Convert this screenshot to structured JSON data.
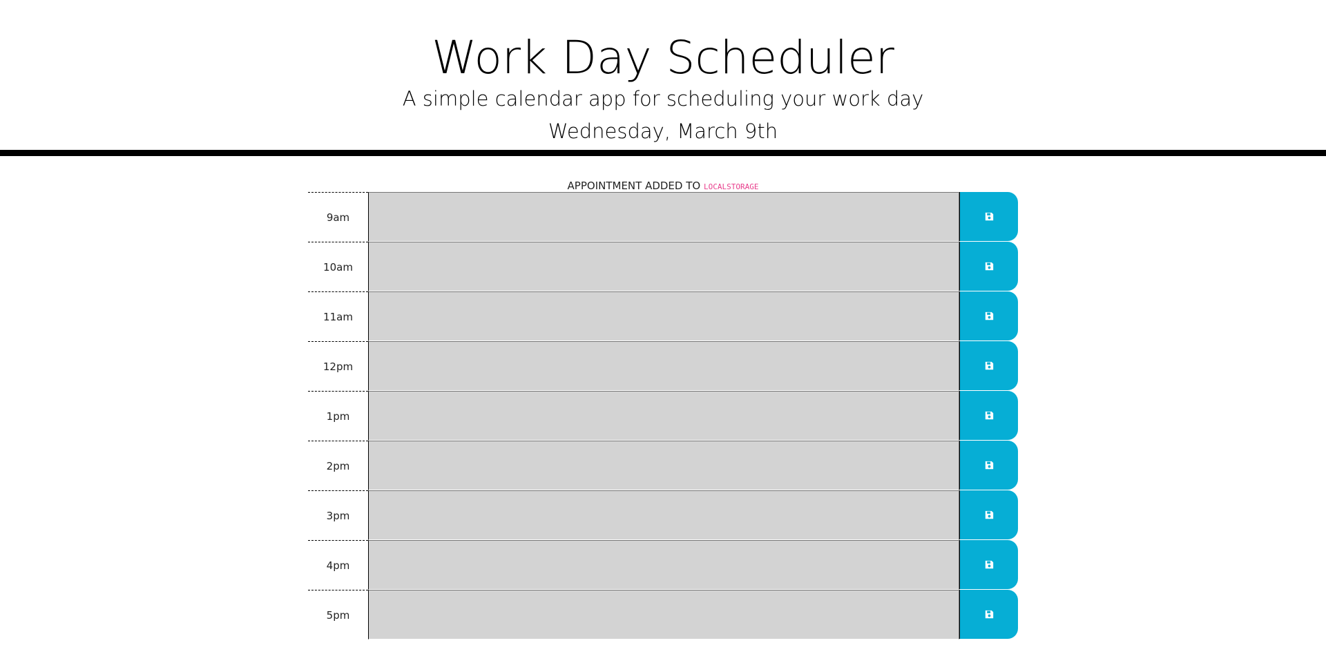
{
  "header": {
    "title": "Work Day Scheduler",
    "subtitle": "A simple calendar app for scheduling your work day",
    "date": "Wednesday, March 9th"
  },
  "notice": {
    "prefix": "Appointment added to",
    "storage": "localStorage"
  },
  "colors": {
    "past": "#d3d3d3",
    "save_button": "#06aed5",
    "code_text": "#e83e8c"
  },
  "icons": {
    "save": "floppy-disk-icon"
  },
  "time_blocks": [
    {
      "hour": "9am",
      "text": ""
    },
    {
      "hour": "10am",
      "text": ""
    },
    {
      "hour": "11am",
      "text": ""
    },
    {
      "hour": "12pm",
      "text": ""
    },
    {
      "hour": "1pm",
      "text": ""
    },
    {
      "hour": "2pm",
      "text": ""
    },
    {
      "hour": "3pm",
      "text": ""
    },
    {
      "hour": "4pm",
      "text": ""
    },
    {
      "hour": "5pm",
      "text": ""
    }
  ]
}
